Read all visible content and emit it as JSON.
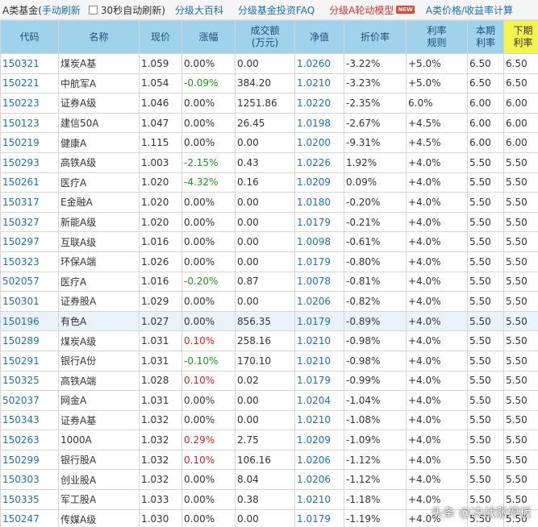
{
  "topbar": {
    "title": "A类基金(",
    "manual_refresh": "手动刷新",
    "auto_refresh": "30秒自动刷新)",
    "encyclopedia": "分级大百科",
    "faq": "分级基金投资FAQ",
    "rotation_model": "分级A轮动模型",
    "new_badge": "NEW",
    "calculator": "A类价格/收益率计算"
  },
  "columns": [
    "代码",
    "名称",
    "现价",
    "涨幅",
    "成交额\n(万元)",
    "净值",
    "折价率",
    "利率\n规则",
    "本期\n利率",
    "下期\n利率"
  ],
  "rows": [
    {
      "code": "150321",
      "name": "煤炭A基",
      "price": "1.059",
      "change": "0.00%",
      "dir": "flat",
      "volume": "0.00",
      "nav": "1.0260",
      "discount": "-3.22%",
      "rule": "+5.0%",
      "cur_rate": "6.50",
      "next_rate": "6.50"
    },
    {
      "code": "150221",
      "name": "中航军A",
      "price": "1.054",
      "change": "-0.09%",
      "dir": "down",
      "volume": "384.20",
      "nav": "1.0210",
      "discount": "-3.23%",
      "rule": "+5.0%",
      "cur_rate": "6.50",
      "next_rate": "6.50"
    },
    {
      "code": "150223",
      "name": "证券A级",
      "price": "1.046",
      "change": "0.00%",
      "dir": "flat",
      "volume": "1251.86",
      "nav": "1.0220",
      "discount": "-2.35%",
      "rule": "6.0%",
      "cur_rate": "6.00",
      "next_rate": "6.00"
    },
    {
      "code": "150123",
      "name": "建信50A",
      "price": "1.047",
      "change": "0.00%",
      "dir": "flat",
      "volume": "26.45",
      "nav": "1.0198",
      "discount": "-2.67%",
      "rule": "+4.5%",
      "cur_rate": "6.00",
      "next_rate": "6.00"
    },
    {
      "code": "150219",
      "name": "健康A",
      "price": "1.115",
      "change": "0.00%",
      "dir": "flat",
      "volume": "0.00",
      "nav": "1.0200",
      "discount": "-9.31%",
      "rule": "+4.5%",
      "cur_rate": "6.00",
      "next_rate": "6.00"
    },
    {
      "code": "150293",
      "name": "高铁A级",
      "price": "1.003",
      "change": "-2.15%",
      "dir": "down",
      "volume": "0.43",
      "nav": "1.0226",
      "discount": "1.92%",
      "rule": "+4.0%",
      "cur_rate": "5.50",
      "next_rate": "5.50"
    },
    {
      "code": "150261",
      "name": "医疗A",
      "price": "1.020",
      "change": "-4.32%",
      "dir": "down",
      "volume": "0.16",
      "nav": "1.0209",
      "discount": "0.09%",
      "rule": "+4.0%",
      "cur_rate": "5.50",
      "next_rate": "5.50"
    },
    {
      "code": "150317",
      "name": "E金融A",
      "price": "1.020",
      "change": "0.00%",
      "dir": "flat",
      "volume": "0.00",
      "nav": "1.0180",
      "discount": "-0.20%",
      "rule": "+4.0%",
      "cur_rate": "5.50",
      "next_rate": "5.50"
    },
    {
      "code": "150327",
      "name": "新能A级",
      "price": "1.020",
      "change": "0.00%",
      "dir": "flat",
      "volume": "0.00",
      "nav": "1.0179",
      "discount": "-0.21%",
      "rule": "+4.0%",
      "cur_rate": "5.50",
      "next_rate": "5.50"
    },
    {
      "code": "150297",
      "name": "互联A级",
      "price": "1.016",
      "change": "0.00%",
      "dir": "flat",
      "volume": "0.00",
      "nav": "1.0098",
      "discount": "-0.61%",
      "rule": "+4.0%",
      "cur_rate": "5.50",
      "next_rate": "5.50"
    },
    {
      "code": "150323",
      "name": "环保A端",
      "price": "1.026",
      "change": "0.00%",
      "dir": "flat",
      "volume": "0.00",
      "nav": "1.0179",
      "discount": "-0.80%",
      "rule": "+4.0%",
      "cur_rate": "5.50",
      "next_rate": "5.50"
    },
    {
      "code": "502057",
      "name": "医疗A",
      "price": "1.016",
      "change": "-0.20%",
      "dir": "down",
      "volume": "0.87",
      "nav": "1.0078",
      "discount": "-0.81%",
      "rule": "+4.0%",
      "cur_rate": "5.50",
      "next_rate": "5.50"
    },
    {
      "code": "150301",
      "name": "证券股A",
      "price": "1.029",
      "change": "0.00%",
      "dir": "flat",
      "volume": "0.00",
      "nav": "1.0206",
      "discount": "-0.82%",
      "rule": "+4.0%",
      "cur_rate": "5.50",
      "next_rate": "5.50"
    },
    {
      "code": "150196",
      "name": "有色A",
      "price": "1.027",
      "change": "0.00%",
      "dir": "flat",
      "volume": "856.35",
      "nav": "1.0179",
      "discount": "-0.89%",
      "rule": "+4.0%",
      "cur_rate": "5.50",
      "next_rate": "5.50",
      "selected": "yes"
    },
    {
      "code": "150289",
      "name": "煤炭A级",
      "price": "1.031",
      "change": "0.10%",
      "dir": "up",
      "volume": "258.16",
      "nav": "1.0210",
      "discount": "-0.98%",
      "rule": "+4.0%",
      "cur_rate": "5.50",
      "next_rate": "5.50"
    },
    {
      "code": "150291",
      "name": "银行A份",
      "price": "1.031",
      "change": "-0.10%",
      "dir": "down",
      "volume": "170.10",
      "nav": "1.0210",
      "discount": "-0.98%",
      "rule": "+4.0%",
      "cur_rate": "5.50",
      "next_rate": "5.50"
    },
    {
      "code": "150325",
      "name": "高铁A端",
      "price": "1.028",
      "change": "0.10%",
      "dir": "up",
      "volume": "0.02",
      "nav": "1.0179",
      "discount": "-0.99%",
      "rule": "+4.0%",
      "cur_rate": "5.50",
      "next_rate": "5.50"
    },
    {
      "code": "502037",
      "name": "网金A",
      "price": "1.031",
      "change": "0.00%",
      "dir": "flat",
      "volume": "0.00",
      "nav": "1.0204",
      "discount": "-1.04%",
      "rule": "+4.0%",
      "cur_rate": "5.50",
      "next_rate": "5.50"
    },
    {
      "code": "150343",
      "name": "证券A基",
      "price": "1.032",
      "change": "0.00%",
      "dir": "flat",
      "volume": "0.00",
      "nav": "1.0210",
      "discount": "-1.08%",
      "rule": "+4.0%",
      "cur_rate": "5.50",
      "next_rate": "5.50"
    },
    {
      "code": "150263",
      "name": "1000A",
      "price": "1.032",
      "change": "0.29%",
      "dir": "up",
      "volume": "2.75",
      "nav": "1.0209",
      "discount": "-1.09%",
      "rule": "+4.0%",
      "cur_rate": "5.50",
      "next_rate": "5.50"
    },
    {
      "code": "150299",
      "name": "银行股A",
      "price": "1.032",
      "change": "0.10%",
      "dir": "up",
      "volume": "106.16",
      "nav": "1.0206",
      "discount": "-1.12%",
      "rule": "+4.0%",
      "cur_rate": "5.50",
      "next_rate": "5.50"
    },
    {
      "code": "150303",
      "name": "创业股A",
      "price": "1.032",
      "change": "0.00%",
      "dir": "flat",
      "volume": "8.04",
      "nav": "1.0206",
      "discount": "-1.12%",
      "rule": "+4.0%",
      "cur_rate": "5.50",
      "next_rate": "5.50"
    },
    {
      "code": "150335",
      "name": "军工股A",
      "price": "1.033",
      "change": "0.00%",
      "dir": "flat",
      "volume": "0.38",
      "nav": "1.0210",
      "discount": "-1.18%",
      "rule": "+4.0%",
      "cur_rate": "5.50",
      "next_rate": "5.50"
    },
    {
      "code": "150247",
      "name": "传媒A级",
      "price": "1.030",
      "change": "0.00%",
      "dir": "flat",
      "volume": "0.00",
      "nav": "1.0179",
      "discount": "-1.19%",
      "rule": "+4.0%",
      "cur_rate": "5.50",
      "next_rate": "5.50"
    }
  ],
  "watermark": "头条 @决战涨停板"
}
